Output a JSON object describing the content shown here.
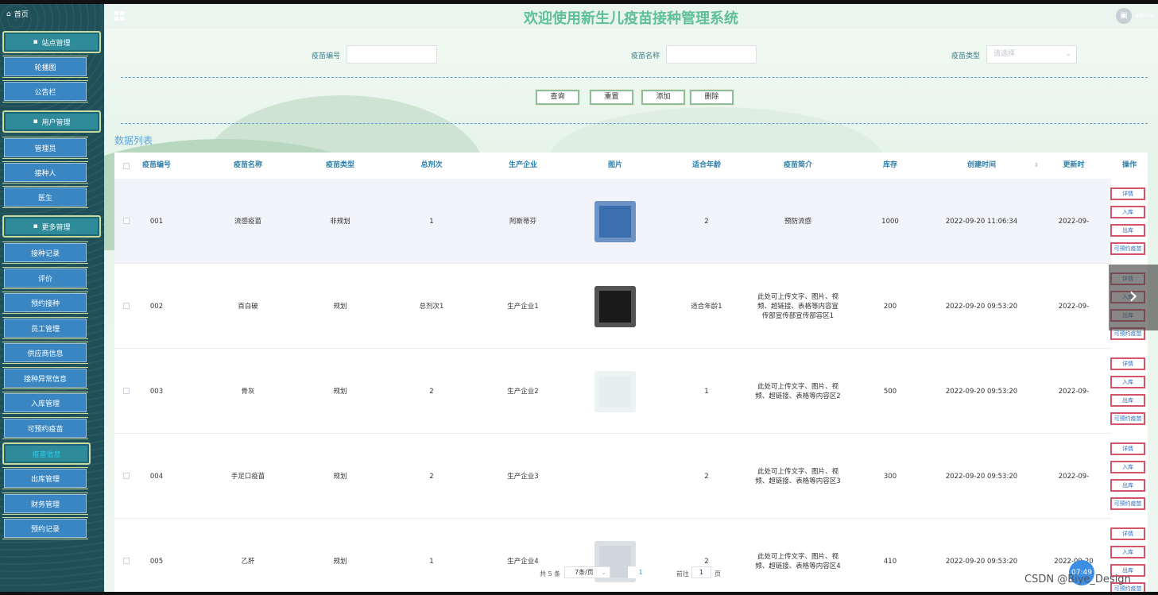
{
  "header": {
    "title": "欢迎使用新生儿疫苗接种管理系统",
    "user": "admin"
  },
  "sidebar": {
    "home": "首页",
    "entries": [
      {
        "type": "group",
        "label": "站点管理",
        "icon": "monitor-icon"
      },
      {
        "type": "item",
        "label": "轮播图"
      },
      {
        "type": "item",
        "label": "公告栏"
      },
      {
        "type": "group",
        "label": "用户管理",
        "icon": "user-icon"
      },
      {
        "type": "item",
        "label": "管理员"
      },
      {
        "type": "item",
        "label": "接种人"
      },
      {
        "type": "item",
        "label": "医生"
      },
      {
        "type": "group",
        "label": "更多管理",
        "icon": "copy-icon"
      },
      {
        "type": "item",
        "label": "接种记录"
      },
      {
        "type": "item",
        "label": "评价"
      },
      {
        "type": "item",
        "label": "预约接种"
      },
      {
        "type": "item",
        "label": "员工管理"
      },
      {
        "type": "item",
        "label": "供应商信息"
      },
      {
        "type": "item",
        "label": "接种异常信息"
      },
      {
        "type": "item",
        "label": "入库管理"
      },
      {
        "type": "item",
        "label": "可预约疫苗"
      },
      {
        "type": "group",
        "label": "疫苗信息",
        "active": true
      },
      {
        "type": "item",
        "label": "出库管理"
      },
      {
        "type": "item",
        "label": "财务管理"
      },
      {
        "type": "item",
        "label": "预约记录"
      }
    ]
  },
  "filters": {
    "code_label": "疫苗编号",
    "code_value": "",
    "name_label": "疫苗名称",
    "name_value": "",
    "type_label": "疫苗类型",
    "type_placeholder": "请选择"
  },
  "actions": {
    "search": "查询",
    "reset": "重置",
    "add": "添加",
    "delete": "删除"
  },
  "section_title": "数据列表",
  "table": {
    "columns": [
      "疫苗编号",
      "疫苗名称",
      "疫苗类型",
      "总剂次",
      "生产企业",
      "图片",
      "适合年龄",
      "疫苗简介",
      "库存",
      "创建时间",
      "更新时",
      "操作"
    ],
    "sort_icon": "sort-icon",
    "rows": [
      {
        "code": "001",
        "name": "流感疫苗",
        "type": "非规划",
        "doses": "1",
        "maker": "阿斯蒂芬",
        "age": "2",
        "intro": "预防流感",
        "stock": "1000",
        "created": "2022-09-20 11:06:34",
        "updated": "2022-09-",
        "thumb_bg": "#3b6fb0"
      },
      {
        "code": "002",
        "name": "百白破",
        "type": "规划",
        "doses": "总剂次1",
        "maker": "生产企业1",
        "age": "适合年龄1",
        "intro": "此处可上传文字、图片、视频、超链接、表格等内容宣传部宣传部宣传部容区1",
        "stock": "200",
        "created": "2022-09-20 09:53:20",
        "updated": "2022-09-",
        "thumb_bg": "#1a1a1a"
      },
      {
        "code": "003",
        "name": "骨灰",
        "type": "规划",
        "doses": "2",
        "maker": "生产企业2",
        "age": "1",
        "intro": "此处可上传文字、图片、视频、超链接、表格等内容区2",
        "stock": "500",
        "created": "2022-09-20 09:53:20",
        "updated": "2022-09-",
        "thumb_bg": "#e6efef"
      },
      {
        "code": "004",
        "name": "手足口疫苗",
        "type": "规划",
        "doses": "2",
        "maker": "生产企业3",
        "age": "2",
        "intro": "此处可上传文字、图片、视频、超链接、表格等内容区3",
        "stock": "300",
        "created": "2022-09-20 09:53:20",
        "updated": "2022-09-",
        "thumb_bg": "#ffffff"
      },
      {
        "code": "005",
        "name": "乙肝",
        "type": "规划",
        "doses": "1",
        "maker": "生产企业4",
        "age": "2",
        "intro": "此处可上传文字、图片、视频、超链接、表格等内容区4",
        "stock": "410",
        "created": "2022-09-20 09:53:20",
        "updated": "2022-09-20",
        "thumb_bg": "#cfd6dc"
      }
    ],
    "row_buttons": [
      "详情",
      "入库",
      "出库",
      "可预约疫苗"
    ]
  },
  "pagination": {
    "total": "共 5 条",
    "page_size": "7条/页",
    "current": "1",
    "goto_label": "前往",
    "goto_value": "1",
    "page_unit": "页"
  },
  "overlay": {
    "timer": "07:49",
    "watermark": "CSDN @Biye_Design",
    "next_arrow": "›"
  }
}
